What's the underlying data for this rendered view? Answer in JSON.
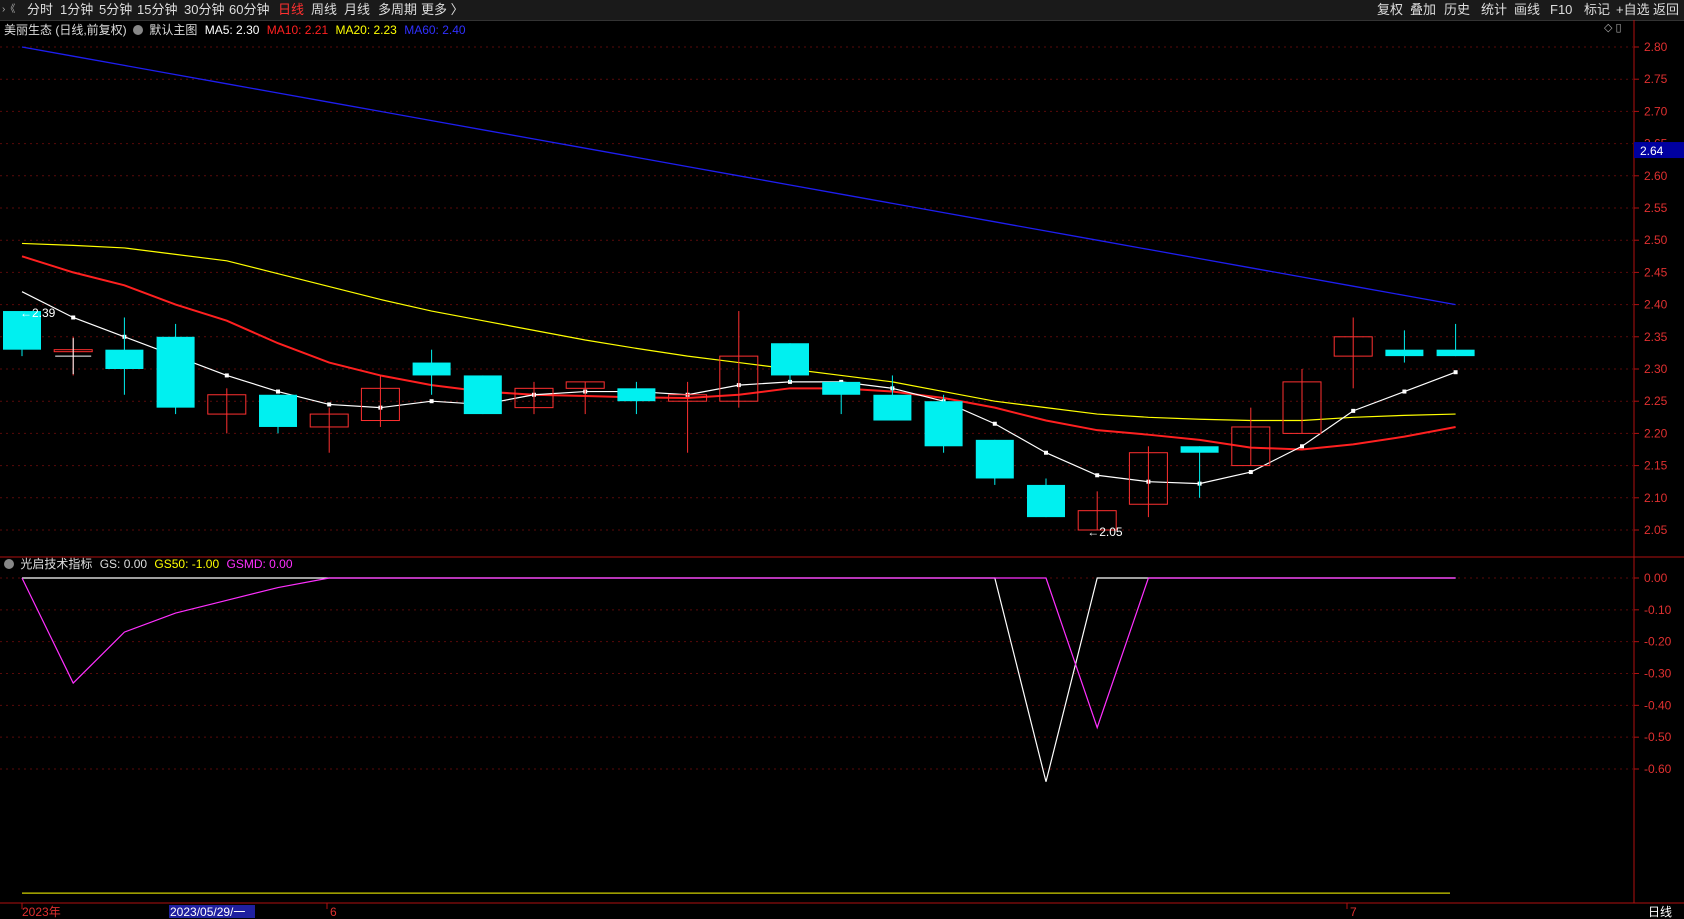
{
  "toolbar": {
    "corner": "›《",
    "periods": [
      "分时",
      "1分钟",
      "5分钟",
      "15分钟",
      "30分钟",
      "60分钟",
      "日线",
      "周线",
      "月线",
      "多周期",
      "更多 〉"
    ],
    "active": "日线",
    "right": [
      "复权",
      "叠加",
      "历史",
      "统计",
      "画线",
      "F10",
      "标记",
      "+自选",
      "返回"
    ]
  },
  "main": {
    "stock_title": "美丽生态 (日线,前复权)",
    "default_label": "默认主图",
    "ma5": "MA5: 2.30",
    "ma10": "MA10: 2.21",
    "ma20": "MA20: 2.23",
    "ma60": "MA60: 2.40",
    "price_marker": "2.64",
    "high_annotation": "←2.39",
    "low_annotation": "←2.05",
    "colors": {
      "ma5": "#ffffff",
      "ma10": "#ff2020",
      "ma20": "#ffff00",
      "ma60": "#1e1ef0",
      "up": "#ff3030",
      "down": "#00f0f0"
    }
  },
  "indicator": {
    "name": "光启技术指标",
    "gs": "GS: 0.00",
    "gs50": "GS50: -1.00",
    "gsmd": "GSMD: 0.00"
  },
  "bottom": {
    "year_label": "2023年",
    "cursor_date": "2023/05/29/一",
    "month_6": "6",
    "month_7": "7",
    "period_label": "日线"
  },
  "chart_data": {
    "type": "candlestick",
    "price_axis_ticks": [
      "2.80",
      "2.75",
      "2.70",
      "2.65",
      "2.60",
      "2.55",
      "2.50",
      "2.45",
      "2.40",
      "2.35",
      "2.30",
      "2.25",
      "2.20",
      "2.15",
      "2.10",
      "2.05"
    ],
    "price_ylim": [
      2.02,
      2.82
    ],
    "candles": [
      {
        "open": 2.39,
        "close": 2.33,
        "high": 2.39,
        "low": 2.32
      },
      {
        "open": 2.33,
        "close": 2.33,
        "high": 2.35,
        "low": 2.29
      },
      {
        "open": 2.33,
        "close": 2.3,
        "high": 2.38,
        "low": 2.26
      },
      {
        "open": 2.35,
        "close": 2.24,
        "high": 2.37,
        "low": 2.23
      },
      {
        "open": 2.23,
        "close": 2.26,
        "high": 2.27,
        "low": 2.2
      },
      {
        "open": 2.26,
        "close": 2.21,
        "high": 2.26,
        "low": 2.2
      },
      {
        "open": 2.21,
        "close": 2.23,
        "high": 2.24,
        "low": 2.17
      },
      {
        "open": 2.22,
        "close": 2.27,
        "high": 2.29,
        "low": 2.21
      },
      {
        "open": 2.31,
        "close": 2.29,
        "high": 2.33,
        "low": 2.26
      },
      {
        "open": 2.29,
        "close": 2.23,
        "high": 2.29,
        "low": 2.23
      },
      {
        "open": 2.24,
        "close": 2.27,
        "high": 2.28,
        "low": 2.23
      },
      {
        "open": 2.27,
        "close": 2.28,
        "high": 2.28,
        "low": 2.23
      },
      {
        "open": 2.27,
        "close": 2.25,
        "high": 2.28,
        "low": 2.23
      },
      {
        "open": 2.25,
        "close": 2.26,
        "high": 2.28,
        "low": 2.17
      },
      {
        "open": 2.25,
        "close": 2.32,
        "high": 2.39,
        "low": 2.24
      },
      {
        "open": 2.34,
        "close": 2.29,
        "high": 2.34,
        "low": 2.28
      },
      {
        "open": 2.28,
        "close": 2.26,
        "high": 2.28,
        "low": 2.23
      },
      {
        "open": 2.26,
        "close": 2.22,
        "high": 2.29,
        "low": 2.22
      },
      {
        "open": 2.25,
        "close": 2.18,
        "high": 2.26,
        "low": 2.17
      },
      {
        "open": 2.19,
        "close": 2.13,
        "high": 2.19,
        "low": 2.12
      },
      {
        "open": 2.12,
        "close": 2.07,
        "high": 2.13,
        "low": 2.07
      },
      {
        "open": 2.05,
        "close": 2.08,
        "high": 2.11,
        "low": 2.05
      },
      {
        "open": 2.09,
        "close": 2.17,
        "high": 2.18,
        "low": 2.07
      },
      {
        "open": 2.18,
        "close": 2.17,
        "high": 2.18,
        "low": 2.1
      },
      {
        "open": 2.15,
        "close": 2.21,
        "high": 2.24,
        "low": 2.15
      },
      {
        "open": 2.2,
        "close": 2.28,
        "high": 2.3,
        "low": 2.2
      },
      {
        "open": 2.32,
        "close": 2.35,
        "high": 2.38,
        "low": 2.27
      },
      {
        "open": 2.33,
        "close": 2.32,
        "high": 2.36,
        "low": 2.31
      },
      {
        "open": 2.33,
        "close": 2.32,
        "high": 2.37,
        "low": 2.32
      }
    ],
    "ma5": [
      2.42,
      2.38,
      2.35,
      2.32,
      2.29,
      2.265,
      2.245,
      2.24,
      2.25,
      2.245,
      2.26,
      2.265,
      2.265,
      2.26,
      2.275,
      2.28,
      2.28,
      2.27,
      2.25,
      2.215,
      2.17,
      2.135,
      2.125,
      2.122,
      2.14,
      2.18,
      2.235,
      2.265,
      2.295
    ],
    "ma10": [
      2.475,
      2.45,
      2.43,
      2.4,
      2.375,
      2.34,
      2.31,
      2.29,
      2.275,
      2.265,
      2.26,
      2.258,
      2.256,
      2.255,
      2.26,
      2.27,
      2.27,
      2.265,
      2.255,
      2.24,
      2.22,
      2.205,
      2.198,
      2.19,
      2.178,
      2.175,
      2.183,
      2.195,
      2.21
    ],
    "ma20": [
      2.495,
      2.492,
      2.488,
      2.478,
      2.468,
      2.448,
      2.428,
      2.408,
      2.39,
      2.375,
      2.36,
      2.345,
      2.332,
      2.32,
      2.31,
      2.3,
      2.29,
      2.28,
      2.265,
      2.25,
      2.24,
      2.23,
      2.225,
      2.222,
      2.22,
      2.22,
      2.225,
      2.228,
      2.23
    ],
    "ma60": [
      2.8,
      2.775,
      2.75,
      2.725,
      2.7,
      2.675,
      2.65,
      2.628,
      2.605,
      2.582,
      2.56,
      2.54,
      2.52,
      2.5,
      2.482,
      2.465,
      2.448,
      2.432,
      2.47,
      2.475,
      2.46,
      2.445,
      2.435,
      2.425,
      2.42,
      2.415,
      2.41,
      2.405,
      2.4
    ],
    "indicator_axis_ticks": [
      "0.00",
      "-0.10",
      "-0.20",
      "-0.30",
      "-0.40",
      "-0.50",
      "-0.60"
    ],
    "indicator_ylim": [
      -0.69,
      0.02
    ],
    "gs_series": [
      0,
      0,
      0,
      0,
      0,
      0,
      0,
      0,
      0,
      0,
      0,
      0,
      0,
      0,
      0,
      0,
      0,
      0,
      0,
      0,
      -0.64,
      0,
      0,
      0,
      0,
      0,
      0,
      0,
      0
    ],
    "gsmd_series": [
      0,
      -0.33,
      -0.17,
      -0.11,
      -0.07,
      -0.03,
      0,
      0,
      0,
      0,
      0,
      0,
      0,
      0,
      0,
      0,
      0,
      0,
      0,
      0,
      0,
      -0.47,
      0,
      0,
      0,
      0,
      0,
      0,
      0
    ]
  }
}
